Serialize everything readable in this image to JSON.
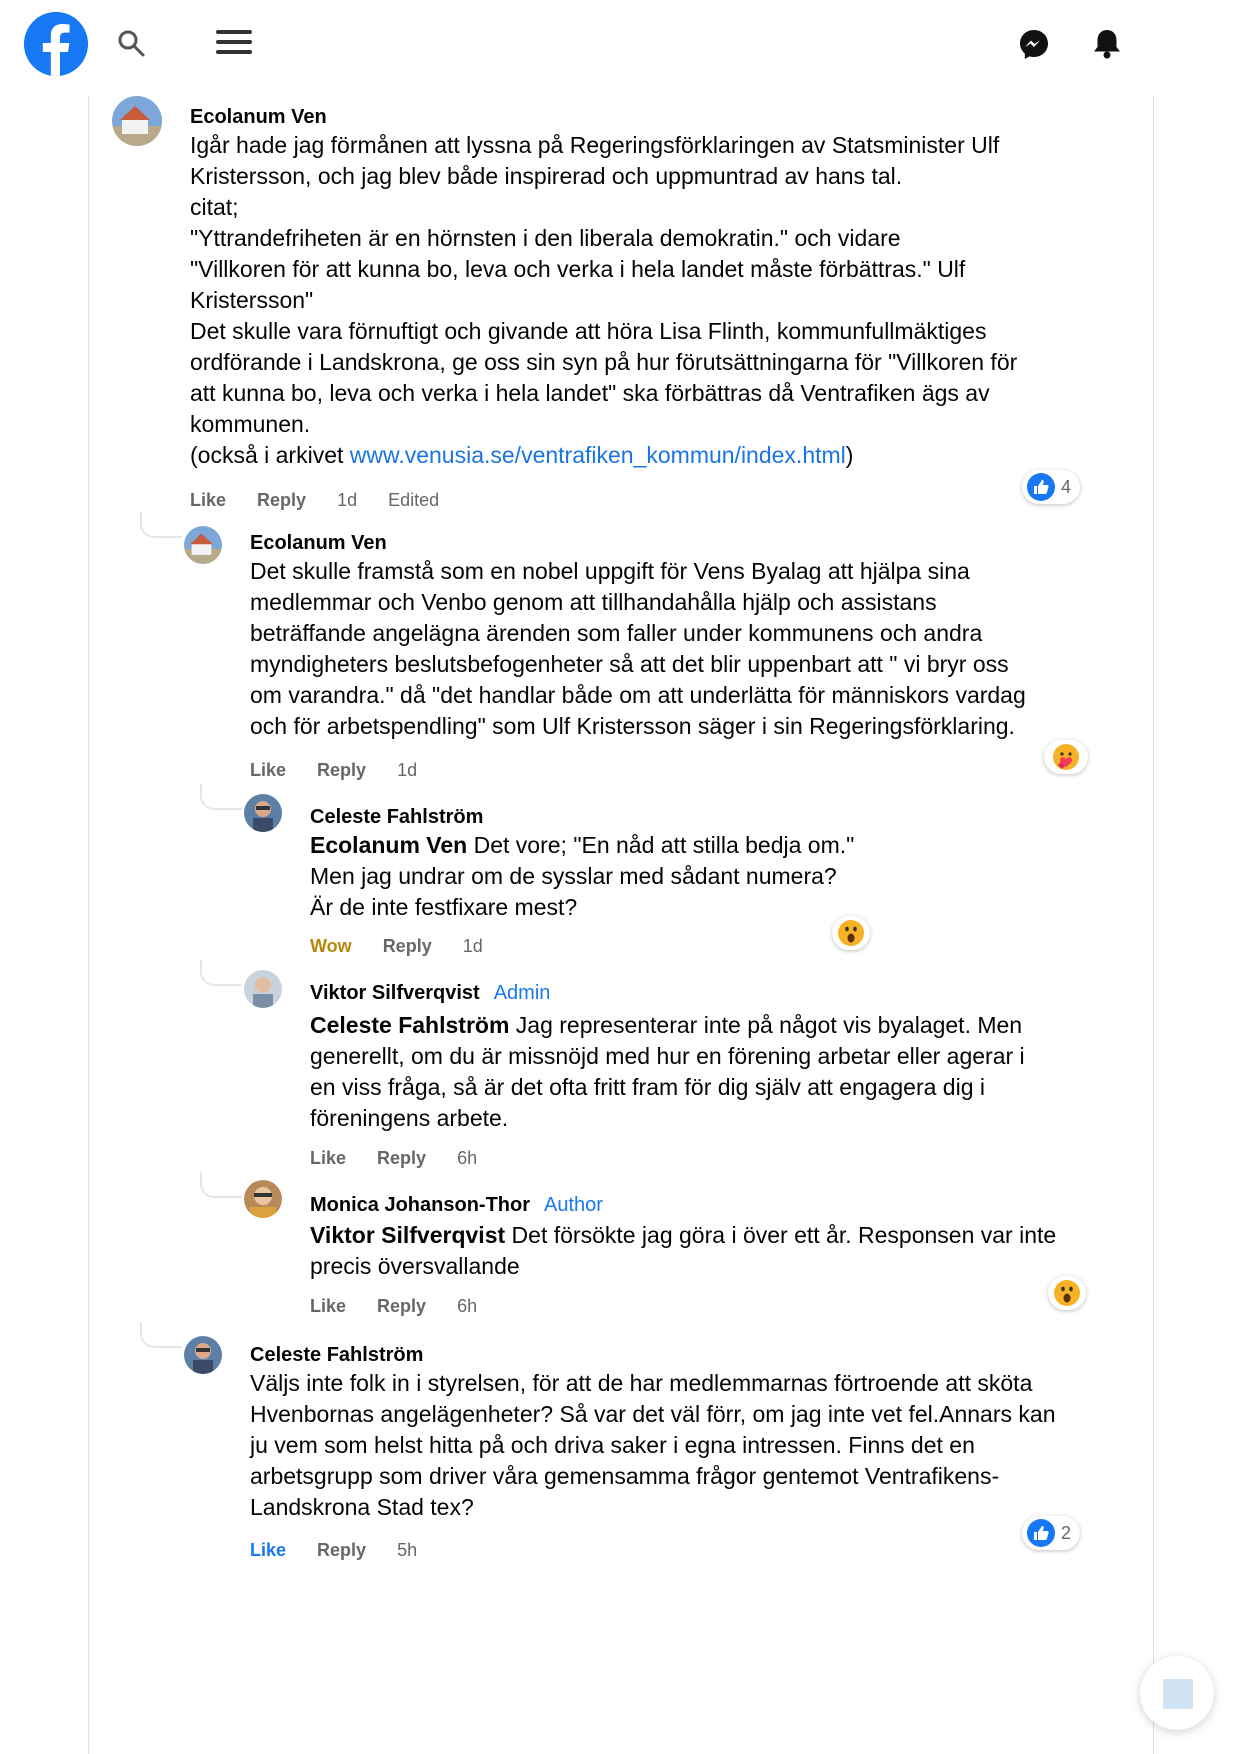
{
  "colors": {
    "brand": "#1877f2",
    "link": "#1b74e4",
    "meta_text": "#65676b",
    "wow_label": "#b8860b"
  },
  "icons": {
    "logo": "facebook-logo-icon",
    "search": "search-icon",
    "menu": "hamburger-menu-icon",
    "messenger": "messenger-icon",
    "notifications": "bell-icon"
  },
  "comments": [
    {
      "author": "Ecolanum Ven",
      "lines": [
        "Igår hade jag förmånen att lyssna på Regeringsförklaringen av Statsminister Ulf",
        "Kristersson, och jag blev både inspirerad och uppmuntrad av hans tal.",
        "citat;",
        "\"Yttrandefriheten är en hörnsten i den liberala demokratin.\" och vidare",
        "\"Villkoren för att kunna bo, leva och verka i hela landet måste förbättras.\" Ulf",
        "Kristersson\"",
        "Det skulle vara förnuftigt och givande att höra Lisa Flinth, kommunfullmäktiges",
        "ordförande i Landskrona, ge oss sin syn på hur förutsättningarna för \"Villkoren för",
        "att kunna bo, leva och verka i hela landet\" ska förbättras då Ventrafiken ägs av",
        "kommunen."
      ],
      "archive_prefix": "(också i arkivet ",
      "archive_link": "www.venusia.se/ventrafiken_kommun/index.html",
      "archive_suffix": ")",
      "like": "Like",
      "reply": "Reply",
      "time": "1d",
      "edited": "Edited",
      "reaction_icon": "like-icon",
      "reaction_count": "4"
    },
    {
      "author": "Ecolanum Ven",
      "lines": [
        "Det skulle framstå som en nobel uppgift för Vens Byalag att hjälpa sina",
        "medlemmar och Venbo genom att tillhandahålla hjälp och assistans",
        "beträffande angelägna ärenden som faller under kommunens och andra",
        "myndigheters beslutsbefogenheter så att det blir uppenbart att \" vi bryr oss",
        "om varandra.\" då \"det handlar både om att underlätta för människors vardag",
        "och för arbetspendling\" som Ulf Kristersson säger i sin Regeringsförklaring."
      ],
      "like": "Like",
      "reply": "Reply",
      "time": "1d",
      "reaction_icon": "care-icon"
    },
    {
      "author": "Celeste Fahlström",
      "mention": "Ecolanum Ven",
      "first_line_rest": " Det vore; \"En nåd att stilla bedja om.\"",
      "lines": [
        "Men jag undrar om de sysslar med sådant numera?",
        "Är de inte festfixare mest?"
      ],
      "like": "Wow",
      "reply": "Reply",
      "time": "1d",
      "reaction_icon": "wow-icon"
    },
    {
      "author": "Viktor Silfverqvist",
      "badge": "Admin",
      "mention": "Celeste Fahlström",
      "first_line_rest": " Jag representerar inte på något vis byalaget. Men",
      "lines": [
        "generellt, om du är missnöjd med hur en förening arbetar eller agerar i",
        "en viss fråga, så är det ofta fritt fram för dig själv att engagera dig i",
        "föreningens arbete."
      ],
      "like": "Like",
      "reply": "Reply",
      "time": "6h"
    },
    {
      "author": "Monica Johanson-Thor",
      "badge": "Author",
      "mention": "Viktor Silfverqvist",
      "first_line_rest": " Det försökte jag göra i över ett år. Responsen var inte",
      "lines": [
        "precis översvallande"
      ],
      "like": "Like",
      "reply": "Reply",
      "time": "6h",
      "reaction_icon": "wow-icon"
    },
    {
      "author": "Celeste Fahlström",
      "lines": [
        "Väljs inte folk in i styrelsen, för att de har medlemmarnas förtroende att sköta",
        "Hvenbornas angelägenheter? Så var det väl förr, om jag inte vet fel.Annars kan",
        "ju vem som helst hitta på och driva saker i egna intressen. Finns det en",
        "arbetsgrupp som driver våra gemensamma frågor gentemot Ventrafikens-",
        "Landskrona Stad tex?"
      ],
      "like": "Like",
      "reply": "Reply",
      "time": "5h",
      "reaction_icon": "like-icon",
      "reaction_count": "2"
    }
  ]
}
